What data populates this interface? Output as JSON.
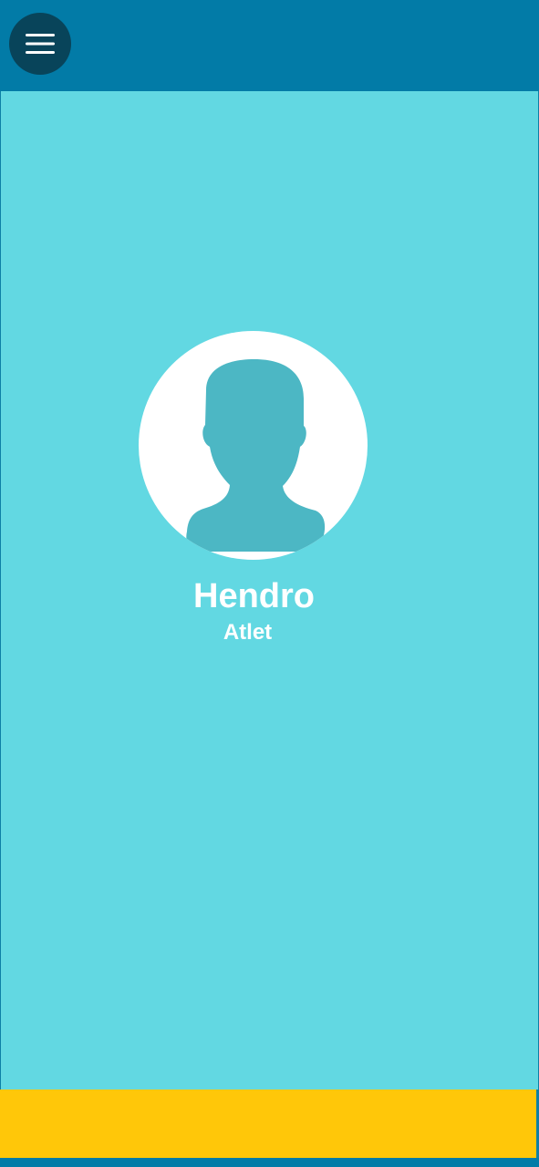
{
  "header": {
    "menu_icon": "hamburger-menu-icon"
  },
  "profile": {
    "name": "Hendro",
    "role": "Atlet",
    "avatar_icon": "user-silhouette-icon"
  },
  "colors": {
    "header_background": "#027ba7",
    "content_background": "#62d8e2",
    "menu_button": "#08445a",
    "footer_background": "#ffc709",
    "avatar_background": "#ffffff",
    "avatar_silhouette": "#4cb7c4"
  }
}
